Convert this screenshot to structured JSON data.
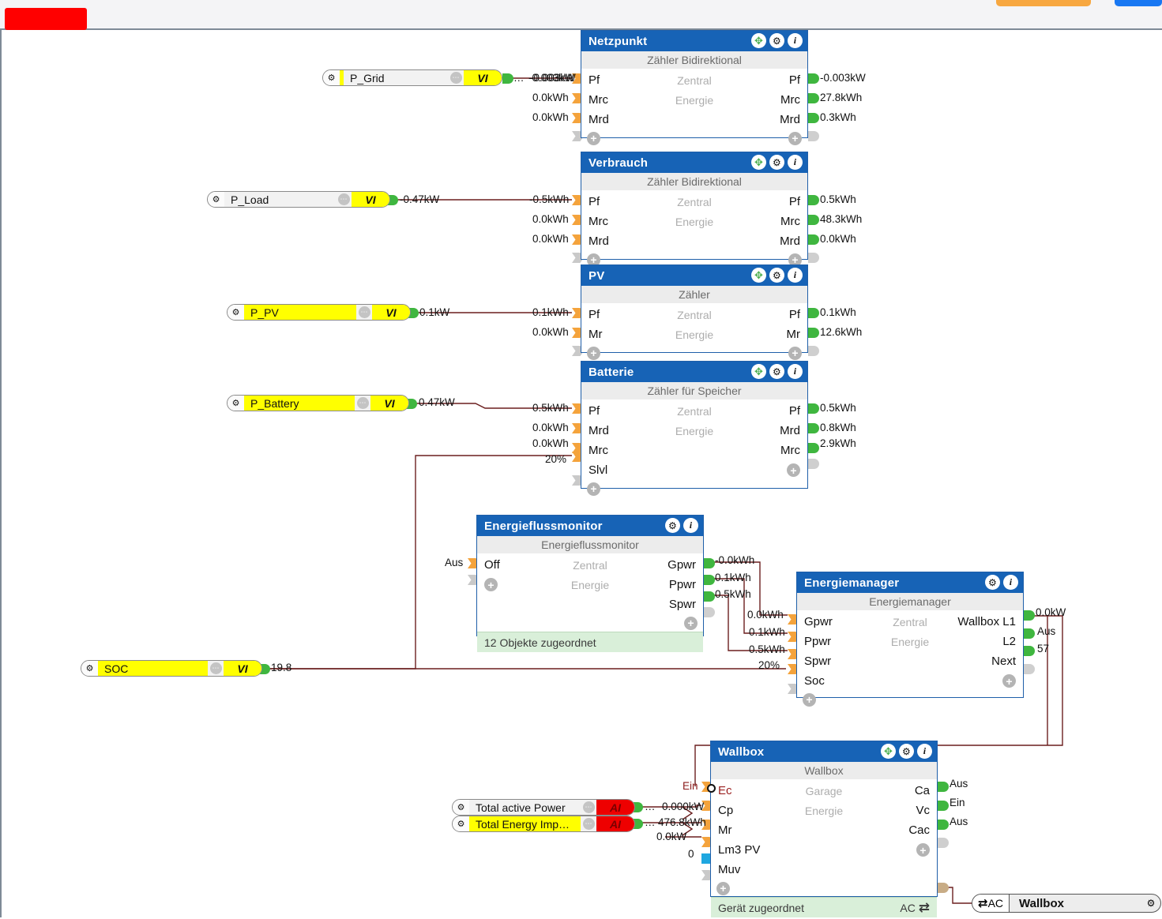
{
  "window": {
    "toolbar_orange_button": "",
    "toolbar_blue_button": ""
  },
  "icons": {
    "gear": "⚙",
    "info": "i",
    "move": "✥",
    "plus": "+",
    "dots": "•••",
    "ac_exchange": "⇄"
  },
  "variables": [
    {
      "name": "P_Grid",
      "type": "VI",
      "highlight": "accent",
      "value": "-0.003kW",
      "prefix": "…"
    },
    {
      "name": "P_Load",
      "type": "VI",
      "highlight": "none",
      "value": "-0.47kW",
      "prefix": ""
    },
    {
      "name": "P_PV",
      "type": "VI",
      "highlight": "yellow",
      "value": "0.1kW",
      "prefix": ""
    },
    {
      "name": "P_Battery",
      "type": "VI",
      "highlight": "yellow",
      "value": "0.47kW",
      "prefix": ""
    },
    {
      "name": "SOC",
      "type": "VI",
      "highlight": "yellow",
      "value": "19.8",
      "prefix": ""
    },
    {
      "name": "Total active Power",
      "type": "AI",
      "highlight": "none",
      "value": "0.000kW",
      "prefix": "…"
    },
    {
      "name": "Total Energy Imp…",
      "type": "AI",
      "highlight": "yellow",
      "value": "476.8kWh",
      "prefix": "…"
    }
  ],
  "nodes": {
    "netzpunkt": {
      "title": "Netzpunkt",
      "subtitle": "Zähler Bidirektional",
      "center_lines": [
        "Zentral",
        "Energie"
      ],
      "inputs": [
        {
          "label": "Pf",
          "value": "-0.003kW"
        },
        {
          "label": "Mrc",
          "value": "0.0kWh"
        },
        {
          "label": "Mrd",
          "value": "0.0kWh"
        }
      ],
      "outputs": [
        {
          "label": "Pf",
          "value": "-0.003kW"
        },
        {
          "label": "Mrc",
          "value": "27.8kWh"
        },
        {
          "label": "Mrd",
          "value": "0.3kWh"
        }
      ]
    },
    "verbrauch": {
      "title": "Verbrauch",
      "subtitle": "Zähler Bidirektional",
      "center_lines": [
        "Zentral",
        "Energie"
      ],
      "inputs": [
        {
          "label": "Pf",
          "value": "-0.5kWh"
        },
        {
          "label": "Mrc",
          "value": "0.0kWh"
        },
        {
          "label": "Mrd",
          "value": "0.0kWh"
        }
      ],
      "outputs": [
        {
          "label": "Pf",
          "value": "0.5kWh"
        },
        {
          "label": "Mrc",
          "value": "48.3kWh"
        },
        {
          "label": "Mrd",
          "value": "0.0kWh"
        }
      ]
    },
    "pv": {
      "title": "PV",
      "subtitle": "Zähler",
      "center_lines": [
        "Zentral",
        "Energie"
      ],
      "inputs": [
        {
          "label": "Pf",
          "value": "0.1kWh"
        },
        {
          "label": "Mr",
          "value": "0.0kWh"
        }
      ],
      "outputs": [
        {
          "label": "Pf",
          "value": "0.1kWh"
        },
        {
          "label": "Mr",
          "value": "12.6kWh"
        }
      ]
    },
    "batterie": {
      "title": "Batterie",
      "subtitle": "Zähler für Speicher",
      "center_lines": [
        "Zentral",
        "Energie"
      ],
      "inputs": [
        {
          "label": "Pf",
          "value": "0.5kWh"
        },
        {
          "label": "Mrd",
          "value": "0.0kWh"
        },
        {
          "label": "Mrc",
          "value": "0.0kWh"
        },
        {
          "label": "Slvl",
          "value": "20%"
        }
      ],
      "outputs": [
        {
          "label": "Pf",
          "value": "0.5kWh"
        },
        {
          "label": "Mrd",
          "value": "0.8kWh"
        },
        {
          "label": "Mrc",
          "value": "2.9kWh"
        }
      ]
    },
    "energieflussmonitor": {
      "title": "Energieflussmonitor",
      "subtitle": "Energieflussmonitor",
      "center_lines": [
        "Zentral",
        "Energie"
      ],
      "footer": "12 Objekte zugeordnet",
      "inputs": [
        {
          "label": "Off",
          "value": "Aus"
        }
      ],
      "outputs": [
        {
          "label": "Gpwr",
          "value": "-0.0kWh"
        },
        {
          "label": "Ppwr",
          "value": "0.1kWh"
        },
        {
          "label": "Spwr",
          "value": "0.5kWh"
        }
      ]
    },
    "energiemanager": {
      "title": "Energiemanager",
      "subtitle": "Energiemanager",
      "center_lines": [
        "Zentral",
        "Energie"
      ],
      "inputs": [
        {
          "label": "Gpwr",
          "value": "0.0kWh"
        },
        {
          "label": "Ppwr",
          "value": "0.1kWh"
        },
        {
          "label": "Spwr",
          "value": "0.5kWh"
        },
        {
          "label": "Soc",
          "value": "20%"
        }
      ],
      "outputs": [
        {
          "label": "Wallbox L1",
          "value": "0.0kW"
        },
        {
          "label": "L2",
          "value": "Aus"
        },
        {
          "label": "Next",
          "value": "57"
        }
      ]
    },
    "wallbox": {
      "title": "Wallbox",
      "subtitle": "Wallbox",
      "center_lines": [
        "Garage",
        "Energie"
      ],
      "footer": "Gerät zugeordnet",
      "footer_right": "AC",
      "inputs": [
        {
          "label": "Ec",
          "value": "Ein"
        },
        {
          "label": "Cp",
          "value": "0.000kW"
        },
        {
          "label": "Mr",
          "value": "476.8kWh"
        },
        {
          "label": "Lm3 PV",
          "value": "0.0kW"
        },
        {
          "label": "Muv",
          "value": "0"
        }
      ],
      "outputs": [
        {
          "label": "Ca",
          "value": "Aus"
        },
        {
          "label": "Vc",
          "value": "Ein"
        },
        {
          "label": "Cac",
          "value": "Aus"
        }
      ]
    }
  },
  "device": {
    "ac_label": "AC",
    "name": "Wallbox"
  },
  "colors": {
    "title_blue": "#1763b6",
    "pin_in_orange": "#f4a33c",
    "pin_out_green": "#3fb63f",
    "wire": "#6b1f1f",
    "footer_green": "#d9efd9",
    "type_vi": "#ffff00",
    "type_ai": "#ee0000",
    "overlay_red": "#ff0000"
  }
}
